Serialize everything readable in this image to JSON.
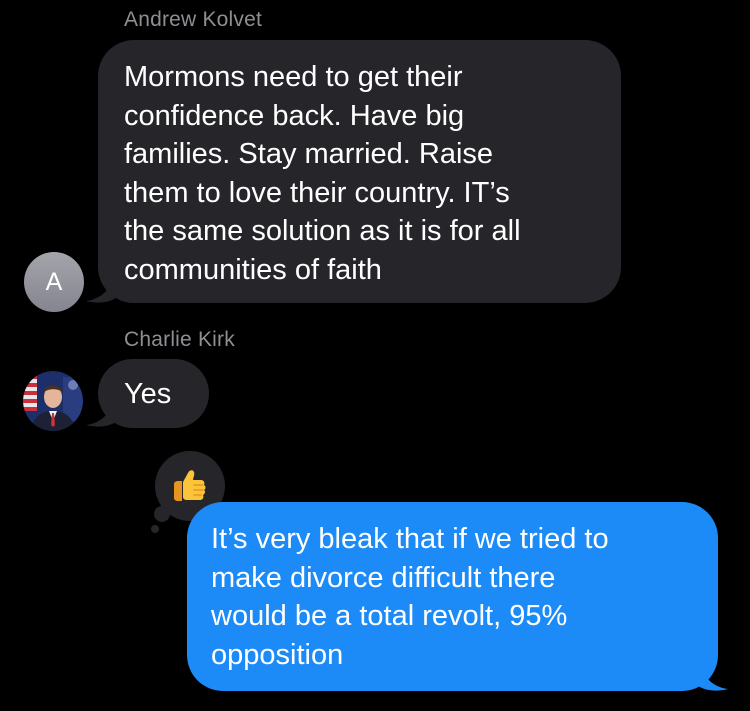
{
  "thread": {
    "messages": [
      {
        "sender": "Andrew Kolvet",
        "avatar_initial": "A",
        "text": "Mormons need to get their\nconfidence back. Have big\nfamilies. Stay married. Raise\nthem to love their country. IT’s\nthe same solution as it is for all\ncommunities of faith"
      },
      {
        "sender": "Charlie Kirk",
        "avatar_icon": "profile-photo-icon",
        "text": "Yes",
        "reaction_icon": "thumbs-up-emoji-icon"
      },
      {
        "sender": "",
        "direction": "outgoing",
        "text": "It’s very bleak that if we tried to\nmake divorce difficult there\nwould be a total revolt, 95%\nopposition"
      }
    ]
  },
  "colors": {
    "background": "#000000",
    "incoming_bubble": "#26252a",
    "outgoing_bubble": "#1c8bf7",
    "sender_name": "#8e8e93",
    "text": "#ffffff"
  }
}
